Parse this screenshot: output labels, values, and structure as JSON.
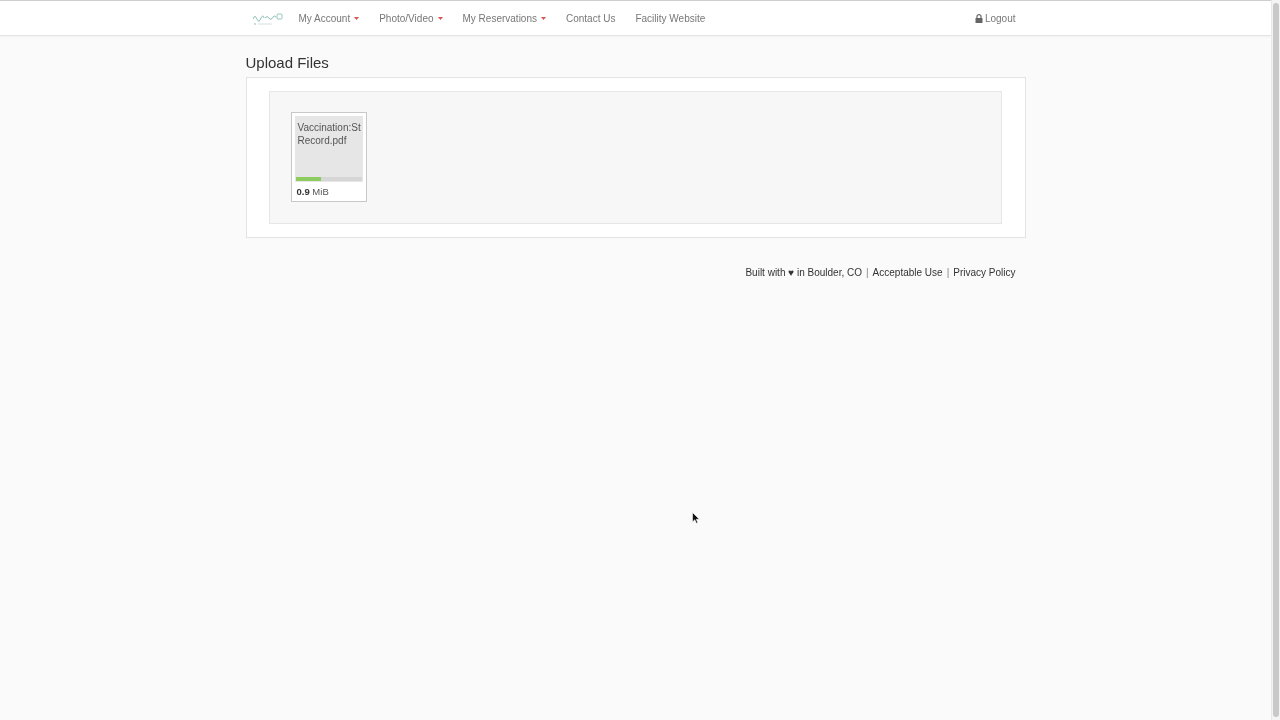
{
  "navbar": {
    "items": [
      {
        "label": "My Account",
        "dropdown": true
      },
      {
        "label": "Photo/Video",
        "dropdown": true
      },
      {
        "label": "My Reservations",
        "dropdown": true
      },
      {
        "label": "Contact Us",
        "dropdown": false
      },
      {
        "label": "Facility Website",
        "dropdown": false
      }
    ],
    "logout": {
      "label": "Logout"
    }
  },
  "page": {
    "title": "Upload Files"
  },
  "upload": {
    "files": [
      {
        "name": "Vaccination:St Record.pdf",
        "level": 0.38,
        "size": "**0.9** MiB"
      }
    ]
  },
  "footer": {
    "items": [
      {
        "kind": "text",
        "text": "Built with ♥ in Boulder, CO"
      },
      {
        "kind": "separator",
        "text": "|"
      },
      {
        "kind": "link",
        "text": "Acceptable Use"
      },
      {
        "kind": "separator",
        "text": "|"
      },
      {
        "kind": "link",
        "text": "Privacy Policy"
      }
    ]
  }
}
